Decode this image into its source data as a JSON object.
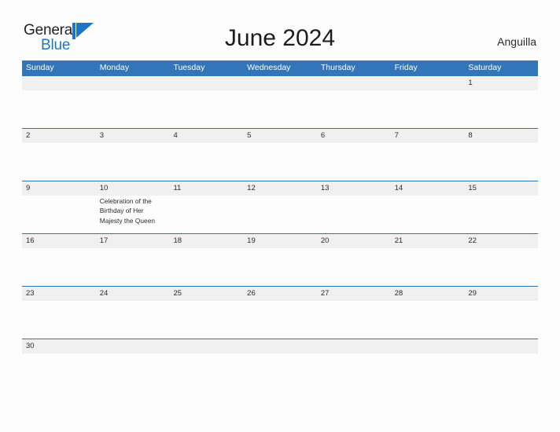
{
  "brand": {
    "word_one": "General",
    "word_two": "Blue",
    "mark_icon": "blue-sail-triangle-icon",
    "color_dark": "#231f20",
    "color_blue": "#1b76c7"
  },
  "header": {
    "title": "June 2024",
    "region": "Anguilla"
  },
  "theme": {
    "header_blue": "#3275b8",
    "rule_blue": "#2f75ae",
    "band_gray": "#f0f0f0",
    "page_background": "#fdfdfd",
    "text_dark": "#2b2b2b"
  },
  "calendar": {
    "month": "June",
    "year": "2024",
    "day_headers": [
      "Sunday",
      "Monday",
      "Tuesday",
      "Wednesday",
      "Thursday",
      "Friday",
      "Saturday"
    ],
    "weeks": [
      {
        "dates": [
          "",
          "",
          "",
          "",
          "",
          "",
          "1"
        ],
        "events": [
          "",
          "",
          "",
          "",
          "",
          "",
          ""
        ]
      },
      {
        "dates": [
          "2",
          "3",
          "4",
          "5",
          "6",
          "7",
          "8"
        ],
        "events": [
          "",
          "",
          "",
          "",
          "",
          "",
          ""
        ]
      },
      {
        "dates": [
          "9",
          "10",
          "11",
          "12",
          "13",
          "14",
          "15"
        ],
        "events": [
          "",
          "Celebration of the Birthday of Her Majesty the Queen",
          "",
          "",
          "",
          "",
          ""
        ]
      },
      {
        "dates": [
          "16",
          "17",
          "18",
          "19",
          "20",
          "21",
          "22"
        ],
        "events": [
          "",
          "",
          "",
          "",
          "",
          "",
          ""
        ]
      },
      {
        "dates": [
          "23",
          "24",
          "25",
          "26",
          "27",
          "28",
          "29"
        ],
        "events": [
          "",
          "",
          "",
          "",
          "",
          "",
          ""
        ]
      },
      {
        "dates": [
          "30",
          "",
          "",
          "",
          "",
          "",
          ""
        ],
        "events": [
          "",
          "",
          "",
          "",
          "",
          "",
          ""
        ]
      }
    ],
    "holidays": [
      {
        "date": "10",
        "name": "Celebration of the Birthday of Her Majesty the Queen"
      }
    ]
  }
}
